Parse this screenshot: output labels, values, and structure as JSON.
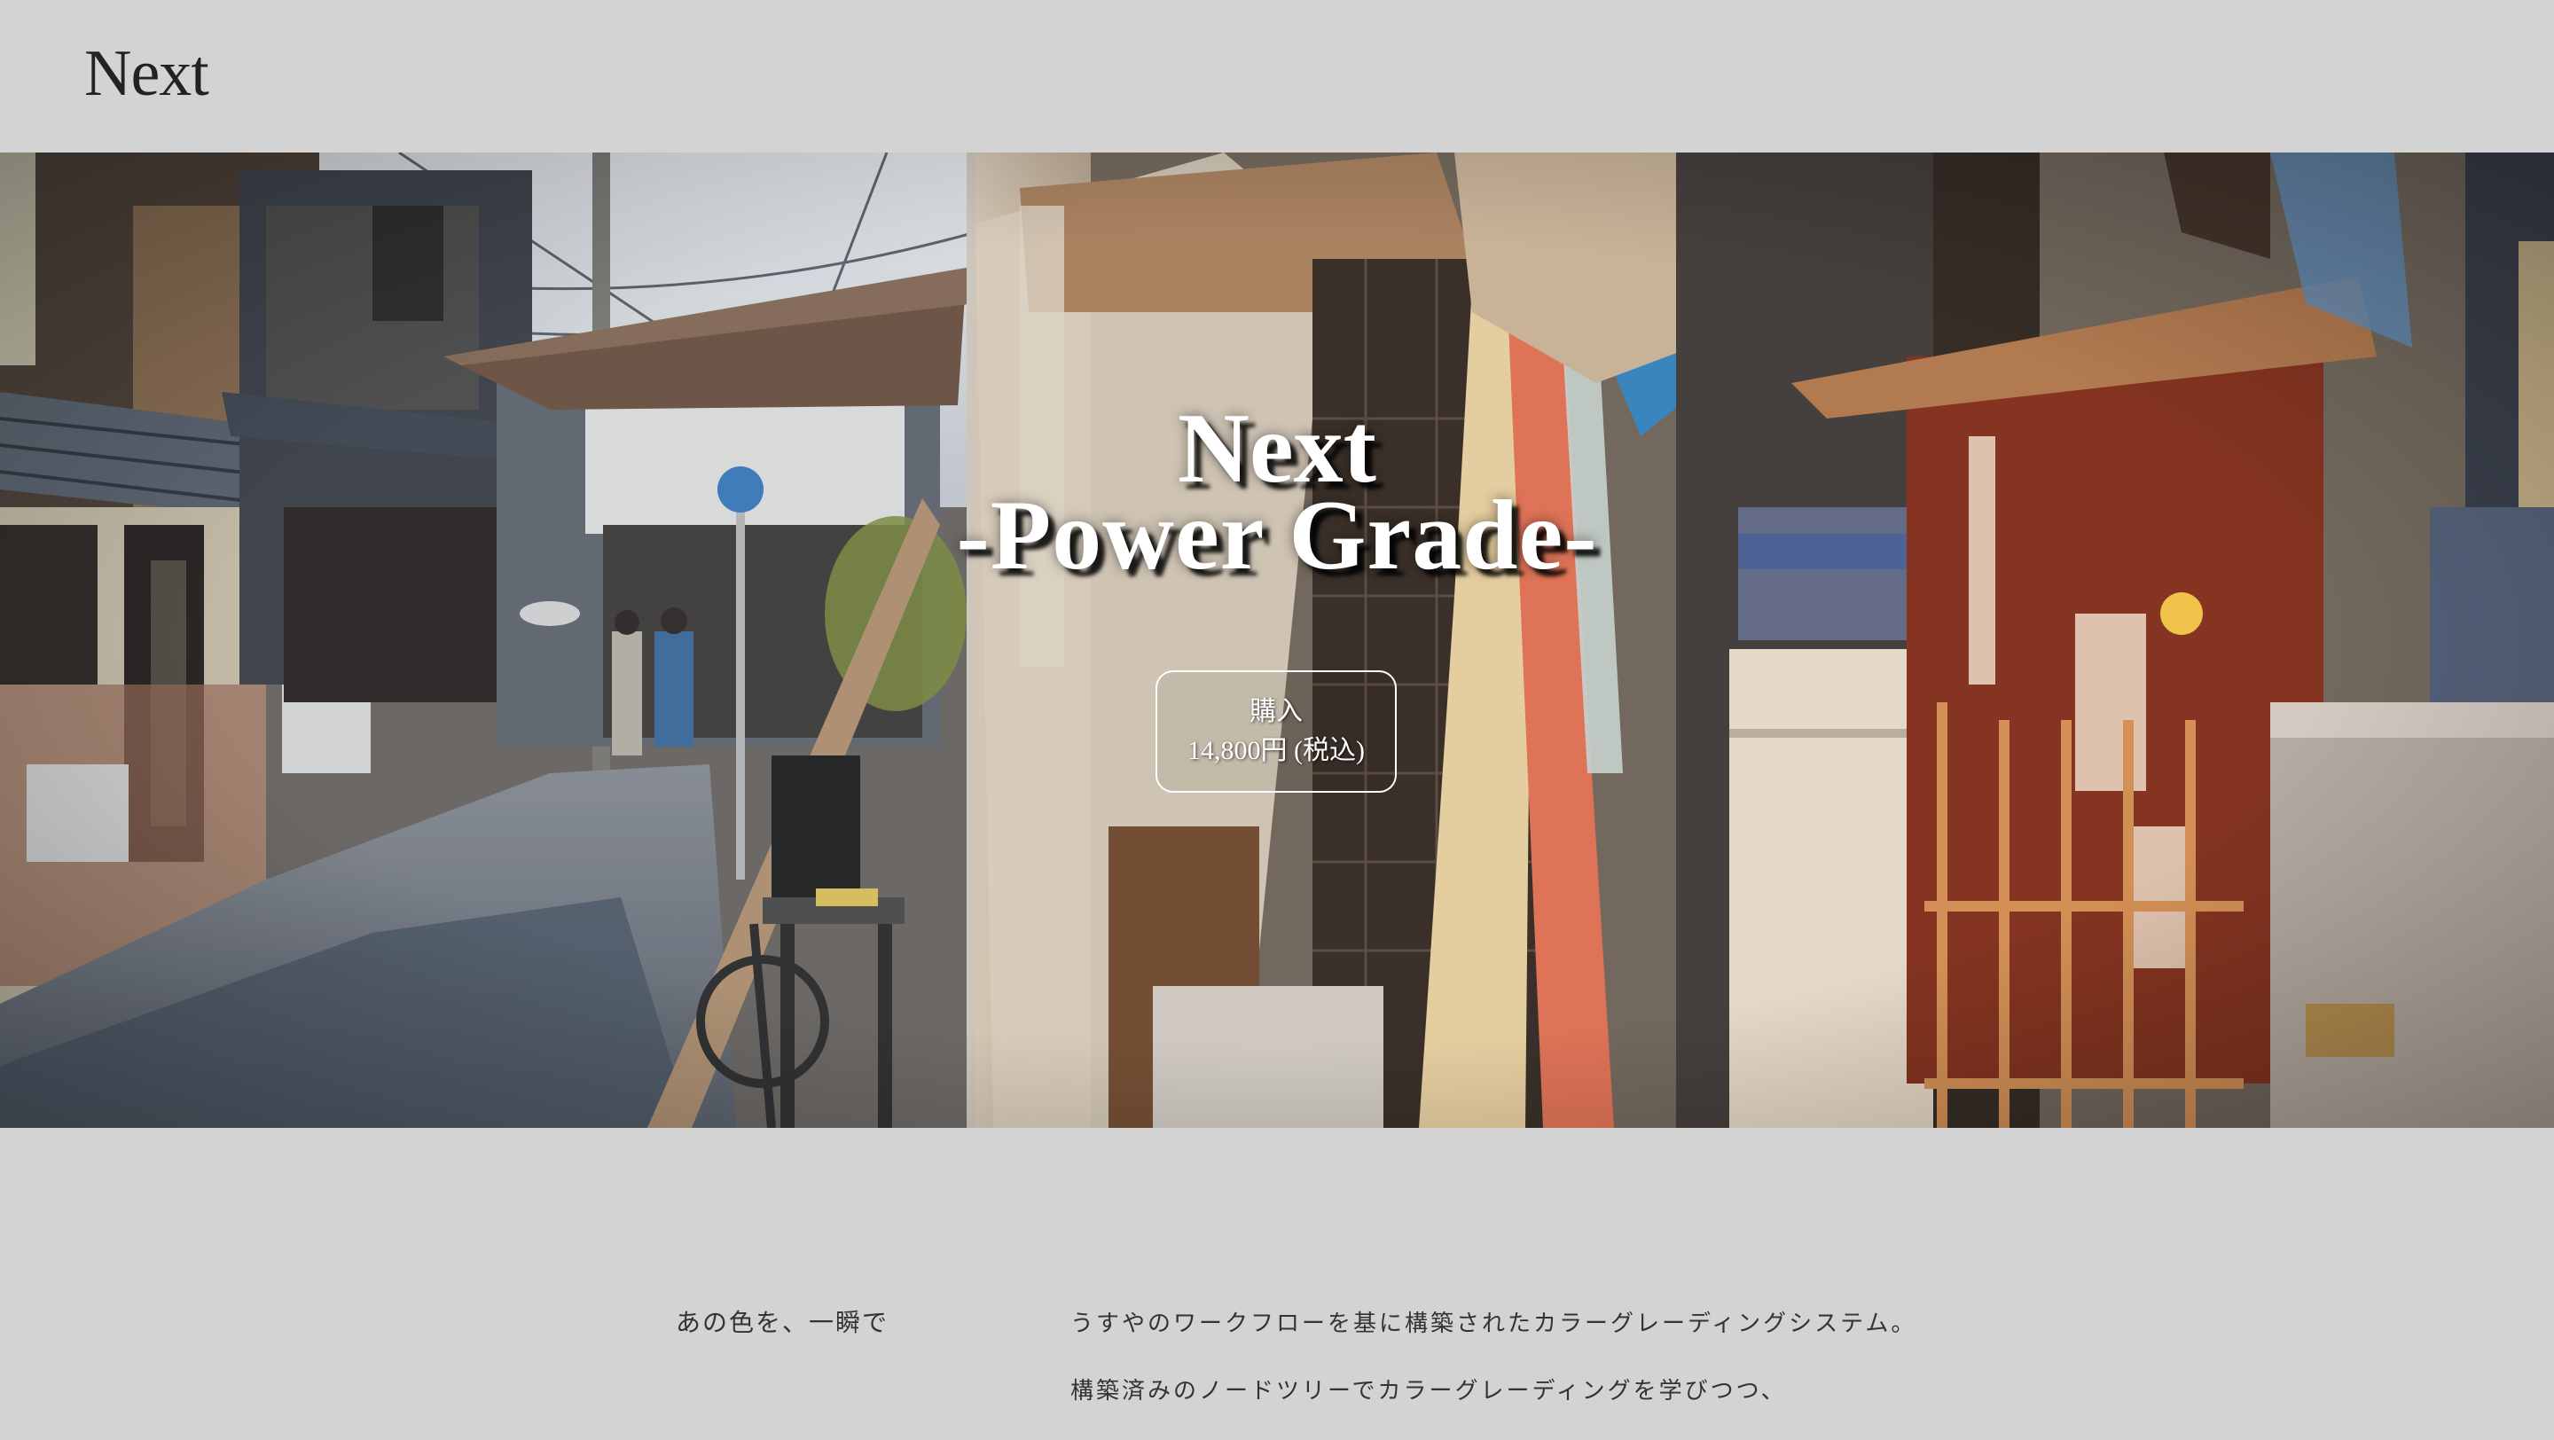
{
  "header": {
    "logo": "Next"
  },
  "hero": {
    "title_line1": "Next",
    "title_line2": "-Power Grade-",
    "buy_button": {
      "label": "購入",
      "price": "14,800円 (税込)"
    }
  },
  "intro": {
    "heading": "あの色を、一瞬で",
    "paragraphs": [
      "うすやのワークフローを基に構築されたカラーグレーディングシステム。",
      "構築済みのノードツリーでカラーグレーディングを学びつつ、"
    ]
  }
}
